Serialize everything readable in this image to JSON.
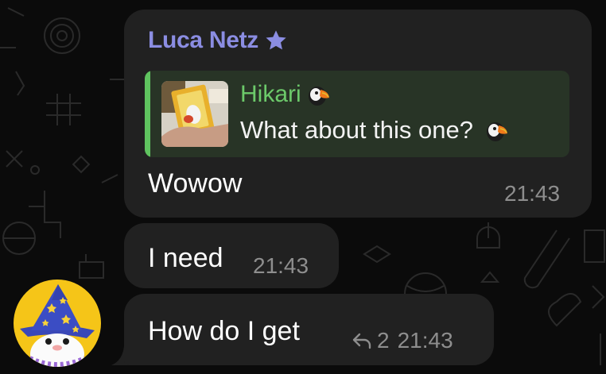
{
  "chat": {
    "colors": {
      "background": "#0b0b0b",
      "bubble": "#212121",
      "sender_name": "#8b8de2",
      "reply_name": "#6cc96a",
      "reply_bar": "#5fc35f",
      "timestamp": "#8e8e8e"
    },
    "sender": {
      "name": "Luca Netz",
      "badge_icon": "star-icon"
    },
    "avatar": {
      "icon": "penguin-wizard-avatar"
    },
    "messages": [
      {
        "reply_to": {
          "name": "Hikari",
          "text": "What about this one?",
          "emoji_icon": "puffin-emoji"
        },
        "text": "Wowow",
        "time": "21:43"
      },
      {
        "text": "I need",
        "time": "21:43"
      },
      {
        "text": "How do I get",
        "time": "21:43",
        "replies_count": "2",
        "replies_icon": "reply-arrow-icon"
      }
    ]
  }
}
